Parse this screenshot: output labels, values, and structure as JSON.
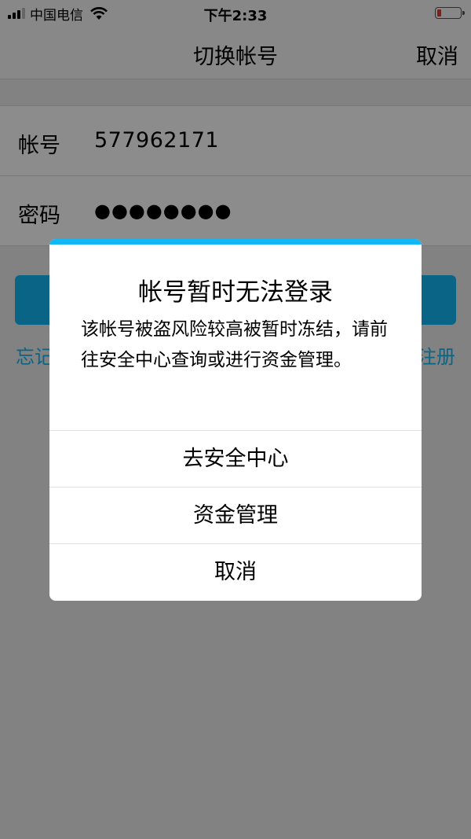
{
  "status_bar": {
    "carrier": "中国电信",
    "time": "下午2:33"
  },
  "nav": {
    "title": "切换帐号",
    "cancel": "取消"
  },
  "form": {
    "account_label": "帐号",
    "account_value": "577962171",
    "password_label": "密码",
    "password_value": "●●●●●●●●"
  },
  "links": {
    "forgot_partial": "忘记",
    "register_partial": "注册"
  },
  "dialog": {
    "title": "帐号暂时无法登录",
    "message": "该帐号被盗风险较高被暂时冻结，请前往安全中心查询或进行资金管理。",
    "buttons": [
      "去安全中心",
      "资金管理",
      "取消"
    ]
  },
  "colors": {
    "accent": "#12b7f5",
    "battery_low": "#e63b2e"
  }
}
